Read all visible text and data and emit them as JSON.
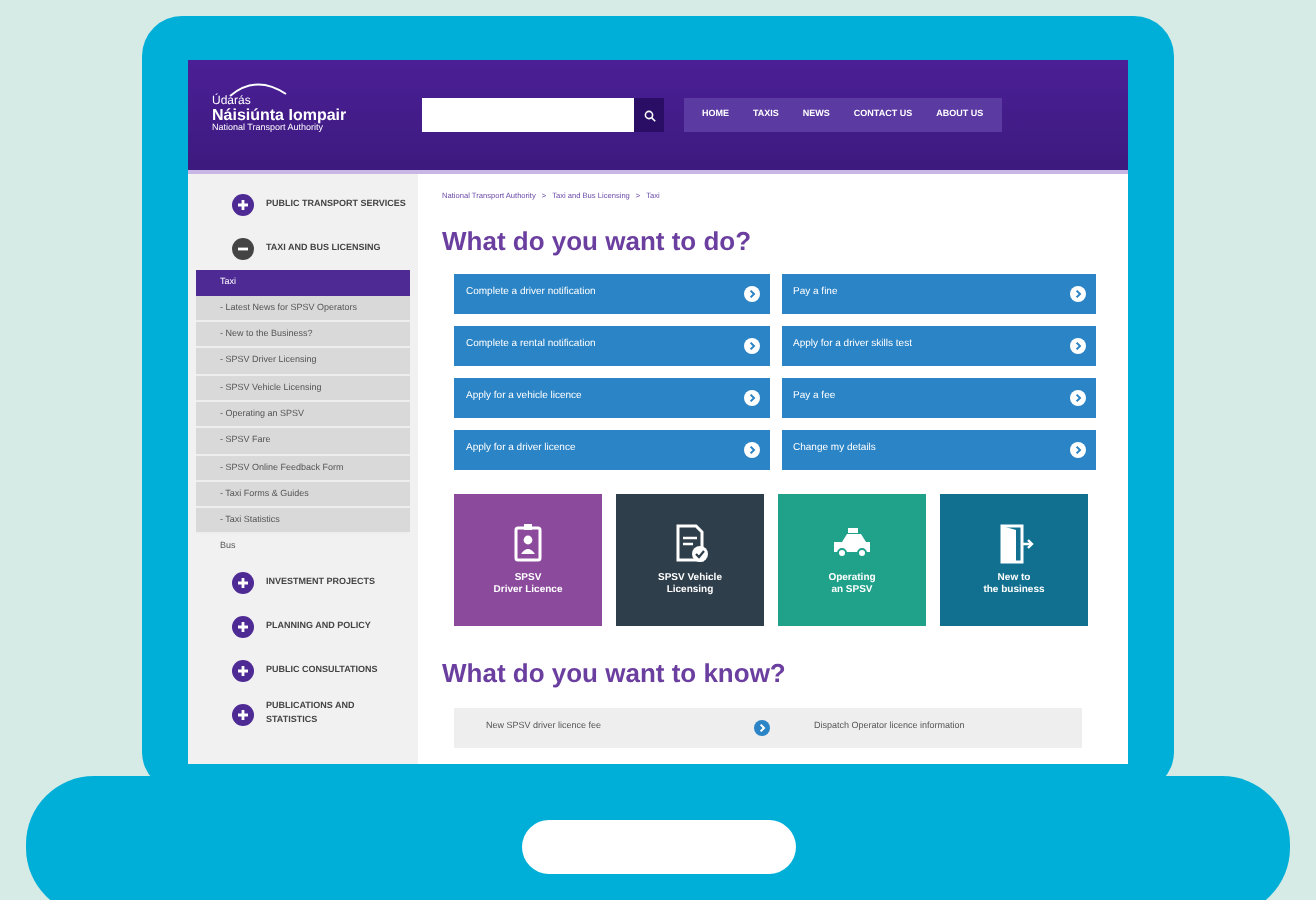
{
  "header": {
    "logo": {
      "line_1": "Údarás",
      "line_2": "Náisiúnta Iompair",
      "line_3": "National Transport Authority"
    },
    "nav": [
      "HOME",
      "TAXIS",
      "NEWS",
      "CONTACT US",
      "ABOUT US"
    ]
  },
  "sidebar": {
    "items": [
      {
        "label": "PUBLIC TRANSPORT SERVICES",
        "expanded": false
      },
      {
        "label": "TAXI AND BUS LICENSING",
        "expanded": true,
        "children": [
          {
            "label": "Taxi",
            "selected": true,
            "children": [
              {
                "label": "- Latest News for SPSV Operators"
              },
              {
                "label": "- New to the Business?"
              },
              {
                "label": "- SPSV Driver Licensing"
              },
              {
                "label": "- SPSV Vehicle Licensing"
              },
              {
                "label": "- Operating an SPSV"
              },
              {
                "label": "- SPSV Fare"
              },
              {
                "label": "- SPSV Online Feedback Form"
              },
              {
                "label": "- Taxi Forms & Guides"
              },
              {
                "label": "- Taxi Statistics"
              }
            ]
          },
          {
            "label": "Bus",
            "selected": false
          }
        ]
      },
      {
        "label": "INVESTMENT PROJECTS",
        "expanded": false
      },
      {
        "label": "PLANNING AND POLICY",
        "expanded": false
      },
      {
        "label": "PUBLIC CONSULTATIONS",
        "expanded": false
      },
      {
        "label": "PUBLICATIONS AND STATISTICS",
        "expanded": false
      }
    ]
  },
  "breadcrumb": [
    "National Transport Authority",
    ">",
    "Taxi and Bus Licensing",
    ">",
    "Taxi"
  ],
  "heading_1": "What do you want to do?",
  "actions": [
    {
      "label": "Complete a driver notification"
    },
    {
      "label": "Pay a fine"
    },
    {
      "label": "Complete a rental notification"
    },
    {
      "label": "Apply for a driver skills test"
    },
    {
      "label": "Apply for a vehicle licence"
    },
    {
      "label": "Pay a fee"
    },
    {
      "label": "Apply for a driver licence"
    },
    {
      "label": "Change my details"
    }
  ],
  "tiles": [
    {
      "kind": "badge",
      "line_1": "SPSV",
      "line_2": "Driver Licence",
      "color": "#8c4a9c"
    },
    {
      "kind": "document",
      "line_1": "SPSV Vehicle",
      "line_2": "Licensing",
      "color": "#2f3e4b"
    },
    {
      "kind": "car",
      "line_1": "Operating",
      "line_2": "an SPSV",
      "color": "#1fa18a"
    },
    {
      "kind": "door",
      "line_1": "New to",
      "line_2": "the business",
      "color": "#11708f"
    }
  ],
  "heading_2": "What do you want to know?",
  "info_row": {
    "left": "New SPSV driver licence fee",
    "right": "Dispatch Operator licence information"
  }
}
